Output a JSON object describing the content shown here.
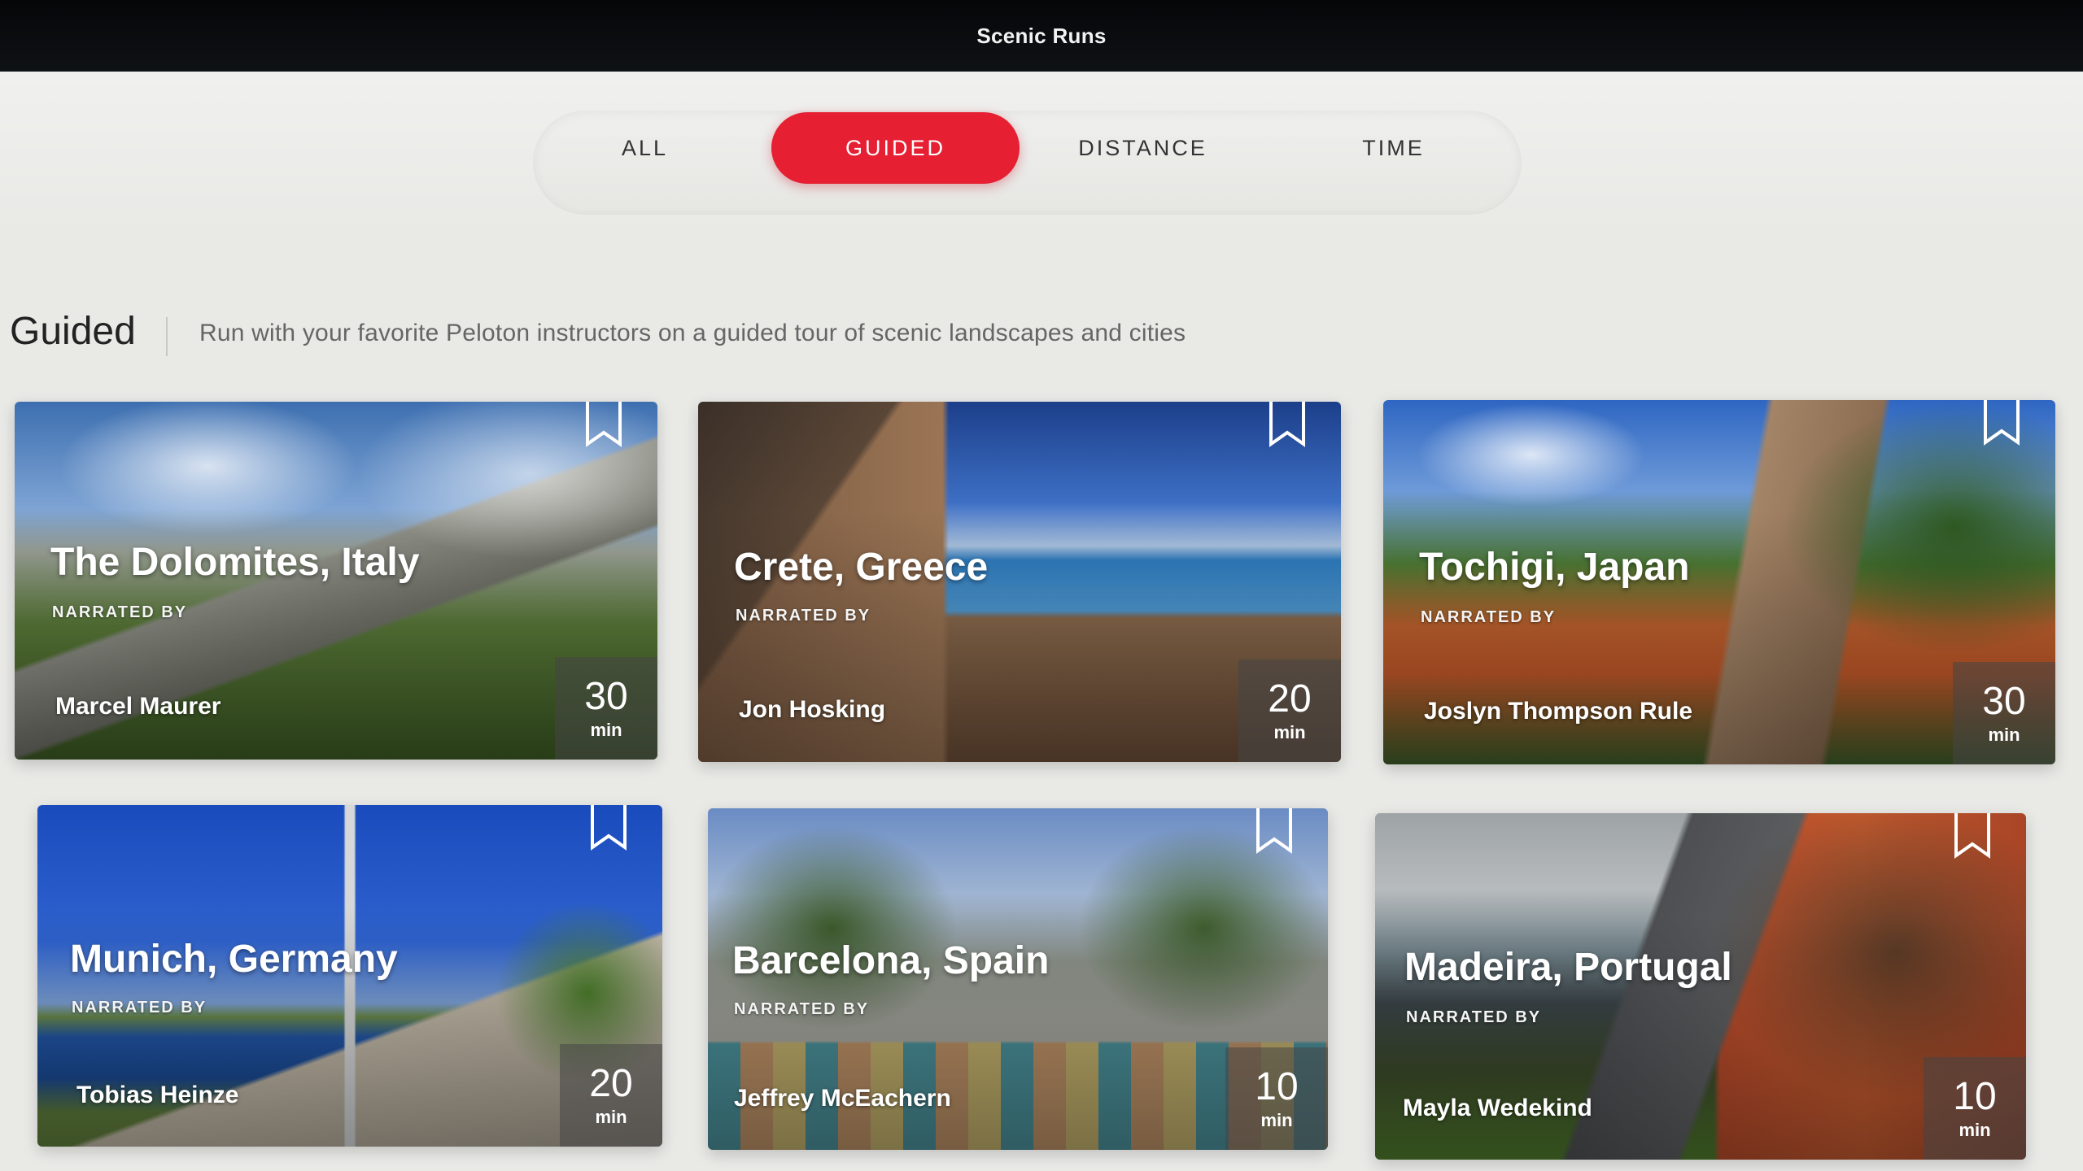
{
  "window": {
    "title": "Scenic Runs"
  },
  "filters": {
    "items": [
      {
        "label": "ALL",
        "active": false
      },
      {
        "label": "GUIDED",
        "active": true
      },
      {
        "label": "DISTANCE",
        "active": false
      },
      {
        "label": "TIME",
        "active": false
      }
    ],
    "active_color": "#e61f32"
  },
  "section": {
    "title": "Guided",
    "description": "Run with your favorite Peloton instructors on a guided tour of scenic landscapes and cities"
  },
  "cards": [
    {
      "title": "The Dolomites, Italy",
      "narrated_by_label": "NARRATED BY",
      "instructor": "Marcel Maurer",
      "duration": "30",
      "unit": "min",
      "bookmark_icon": "bookmark-icon"
    },
    {
      "title": "Crete, Greece",
      "narrated_by_label": "NARRATED BY",
      "instructor": "Jon Hosking",
      "duration": "20",
      "unit": "min",
      "bookmark_icon": "bookmark-icon"
    },
    {
      "title": "Tochigi, Japan",
      "narrated_by_label": "NARRATED BY",
      "instructor": "Joslyn Thompson Rule",
      "duration": "30",
      "unit": "min",
      "bookmark_icon": "bookmark-icon"
    },
    {
      "title": "Munich, Germany",
      "narrated_by_label": "NARRATED BY",
      "instructor": "Tobias Heinze",
      "duration": "20",
      "unit": "min",
      "bookmark_icon": "bookmark-icon"
    },
    {
      "title": "Barcelona, Spain",
      "narrated_by_label": "NARRATED BY",
      "instructor": "Jeffrey McEachern",
      "duration": "10",
      "unit": "min",
      "bookmark_icon": "bookmark-icon"
    },
    {
      "title": "Madeira, Portugal",
      "narrated_by_label": "NARRATED BY",
      "instructor": "Mayla Wedekind",
      "duration": "10",
      "unit": "min",
      "bookmark_icon": "bookmark-icon"
    }
  ]
}
